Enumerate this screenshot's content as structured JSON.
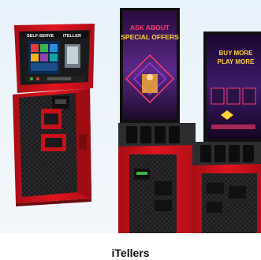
{
  "card": {
    "caption": "iTellers"
  },
  "kiosk_left": {
    "brand_left": "SELF-SERVE",
    "brand_right": "ITELLER"
  },
  "kiosk_middle": {
    "headline_1": "ASK ABOUT",
    "headline_2": "SPECIAL OFFERS"
  },
  "kiosk_right": {
    "headline_1": "BUY MORE",
    "headline_2": "PLAY MORE"
  },
  "colors": {
    "kiosk_red": "#d1121c",
    "dark_panel": "#1c1c1e",
    "neon_pink": "#ff3b6b",
    "neon_yellow": "#ffd23a",
    "screen_purple": "#5a2a8a",
    "background": "#eaf3fa"
  }
}
